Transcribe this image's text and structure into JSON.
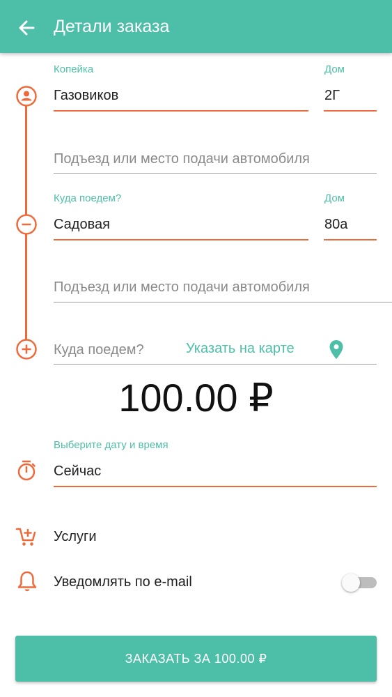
{
  "appbar": {
    "title": "Детали заказа",
    "back_icon": "arrow-left-icon"
  },
  "pickup": {
    "street_label": "Копейка",
    "street_value": "Газовиков",
    "house_label": "Дом",
    "house_value": "2Г",
    "entrance_placeholder": "Подъезд или место подачи автомобиля"
  },
  "destination": {
    "street_label": "Куда поедем?",
    "street_value": "Садовая",
    "house_label": "Дом",
    "house_value": "80а",
    "entrance_placeholder": "Подъезд или место подачи автомобиля"
  },
  "add_stop": {
    "placeholder": "Куда поедем?",
    "map_link": "Указать на карте"
  },
  "price": "100.00 ₽",
  "datetime": {
    "label": "Выберите дату и время",
    "value": "Сейчас"
  },
  "services": {
    "label": "Услуги"
  },
  "notify": {
    "label": "Уведомлять по e-mail",
    "enabled": false
  },
  "order_button": {
    "label": "ЗАКАЗАТЬ ЗА 100.00 ₽"
  },
  "colors": {
    "accent": "#4dbfa8",
    "route": "#ef6a3a",
    "text": "#212121",
    "hint": "#8a8a8a"
  }
}
